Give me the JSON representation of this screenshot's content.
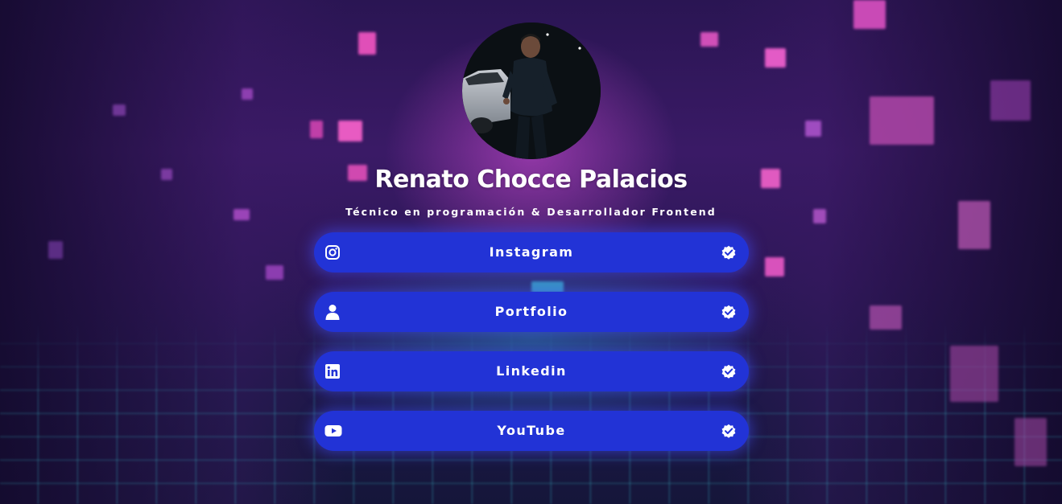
{
  "profile": {
    "name": "Renato Chocce Palacios",
    "subtitle": "Técnico en programación & Desarrollador Frontend"
  },
  "links": [
    {
      "label": "Instagram",
      "icon": "instagram-icon",
      "verified_icon": "verified-badge-icon"
    },
    {
      "label": "Portfolio",
      "icon": "user-icon",
      "verified_icon": "verified-badge-icon"
    },
    {
      "label": "Linkedin",
      "icon": "linkedin-icon",
      "verified_icon": "verified-badge-icon"
    },
    {
      "label": "YouTube",
      "icon": "youtube-icon",
      "verified_icon": "verified-badge-icon"
    }
  ],
  "colors": {
    "button_bg": "#2233d6",
    "button_glow": "#4650ff",
    "text": "#ffffff",
    "background_top": "#2a1553",
    "background_bottom": "#15163a"
  }
}
